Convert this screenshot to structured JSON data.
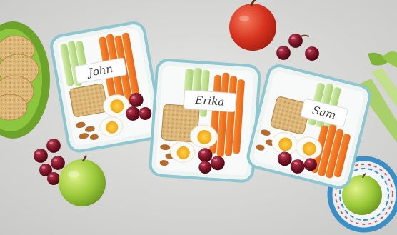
{
  "containers": [
    {
      "label": "John"
    },
    {
      "label": "Erika"
    },
    {
      "label": "Sam"
    }
  ],
  "colors": {
    "background": "#d8d8d6",
    "container_edge": "#8fc6cf",
    "carrot": "#f07a22",
    "celery": "#b8d98a",
    "egg_yolk": "#f6b81c",
    "grape": "#7a1425",
    "apple_red": "#d7331f",
    "apple_green": "#9cca3a",
    "plate_green": "#8cc63f",
    "bowl_blue": "#3c8fc4"
  }
}
